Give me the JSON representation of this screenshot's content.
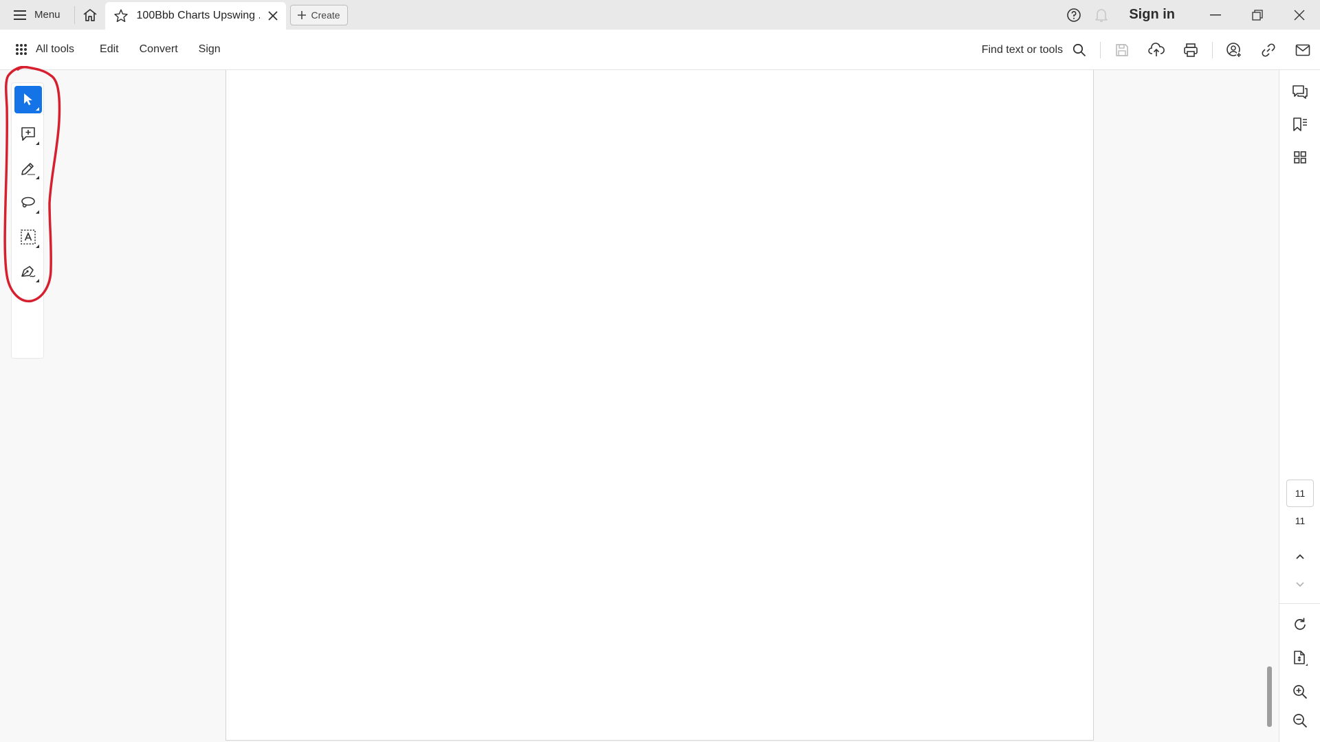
{
  "titlebar": {
    "menu_label": "Menu",
    "tab_title": "100Bbb Charts Upswing ...",
    "create_label": "Create",
    "signin_label": "Sign in"
  },
  "toolbar": {
    "all_tools_label": "All tools",
    "menu_items": [
      "Edit",
      "Convert",
      "Sign"
    ],
    "find_label": "Find text or tools"
  },
  "left_tools": [
    {
      "name": "select-tool",
      "icon": "cursor-icon",
      "active": true
    },
    {
      "name": "add-comment-tool",
      "icon": "comment-add-icon",
      "active": false
    },
    {
      "name": "highlight-tool",
      "icon": "pen-highlight-icon",
      "active": false
    },
    {
      "name": "draw-freeform-tool",
      "icon": "lasso-icon",
      "active": false
    },
    {
      "name": "add-text-tool",
      "icon": "text-box-icon",
      "active": false
    },
    {
      "name": "fill-sign-tool",
      "icon": "pen-sign-icon",
      "active": false
    }
  ],
  "right_rail": {
    "current_page": "11",
    "total_pages": "11"
  },
  "colors": {
    "accent": "#1473e6",
    "annotation": "#d6202f",
    "titlebar_bg": "#e9e9e9"
  }
}
